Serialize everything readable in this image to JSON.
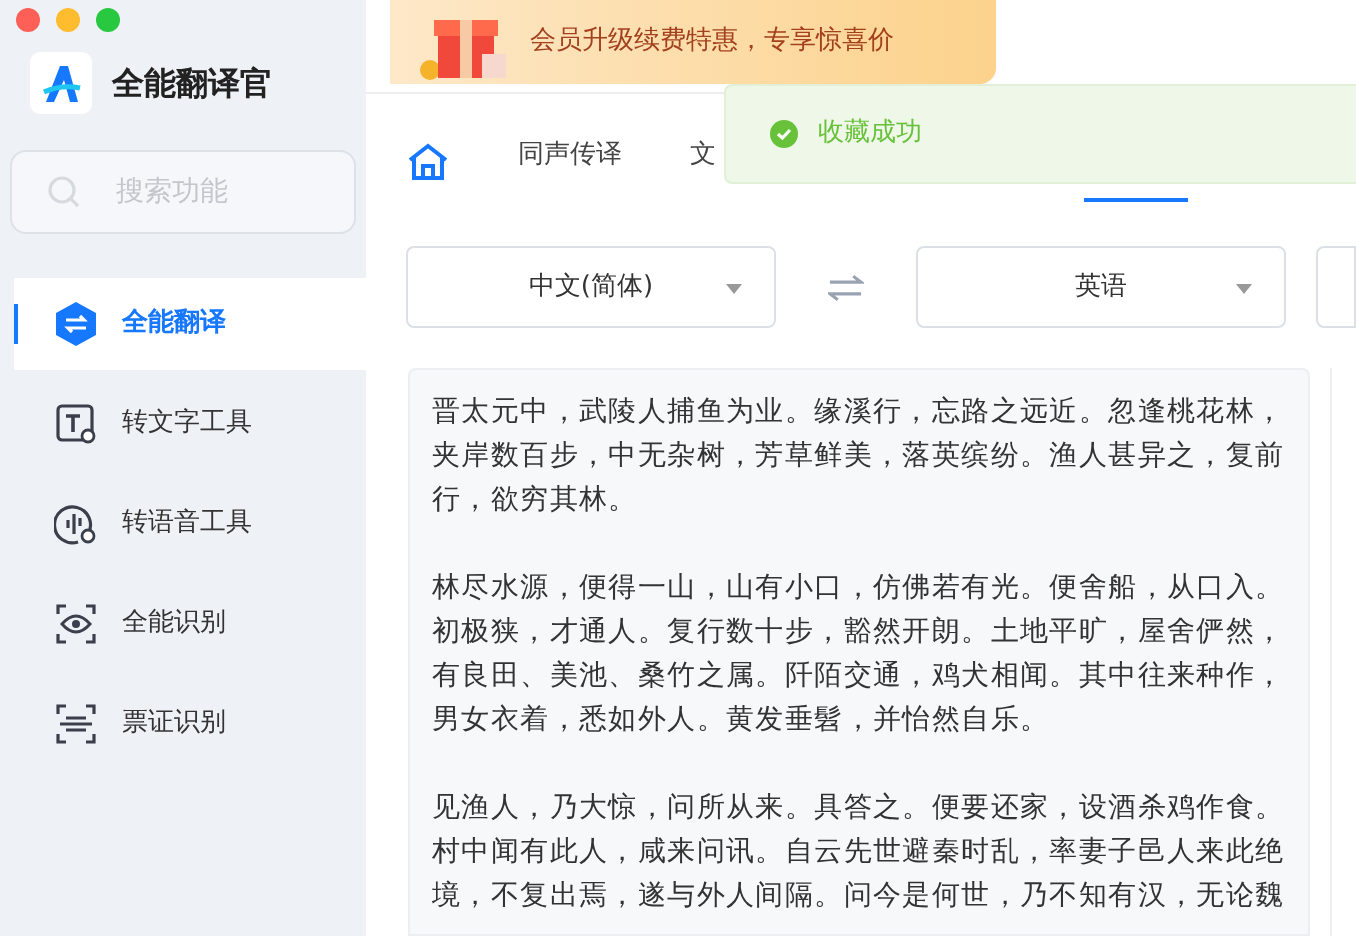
{
  "app": {
    "title": "全能翻译官"
  },
  "search": {
    "placeholder": "搜索功能"
  },
  "sidebar": {
    "items": [
      {
        "label": "全能翻译",
        "kind": "translate",
        "selected": true
      },
      {
        "label": "转文字工具",
        "kind": "text",
        "selected": false
      },
      {
        "label": "转语音工具",
        "kind": "voice",
        "selected": false
      },
      {
        "label": "全能识别",
        "kind": "eye",
        "selected": false
      },
      {
        "label": "票证识别",
        "kind": "scan",
        "selected": false
      }
    ]
  },
  "banner": {
    "text": "会员升级续费特惠，专享惊喜价"
  },
  "toast": {
    "kind": "success",
    "message": "收藏成功"
  },
  "tabs": [
    {
      "label": "同声传译",
      "selected": false
    },
    {
      "label": "文",
      "selected": false
    },
    {
      "selected": true
    }
  ],
  "languages": {
    "source": "中文(简体)",
    "target": "英语"
  },
  "source_text": [
    "晋太元中，武陵人捕鱼为业。缘溪行，忘路之远近。忽逢桃花林，夹岸数百步，中无杂树，芳草鲜美，落英缤纷。渔人甚异之，复前行，欲穷其林。",
    "林尽水源，便得一山，山有小口，仿佛若有光。便舍船，从口入。初极狭，才通人。复行数十步，豁然开朗。土地平旷，屋舍俨然，有良田、美池、桑竹之属。阡陌交通，鸡犬相闻。其中往来种作，男女衣着，悉如外人。黄发垂髫，并怡然自乐。",
    "见渔人，乃大惊，问所从来。具答之。便要还家，设酒杀鸡作食。村中闻有此人，咸来问讯。自云先世避秦时乱，率妻子邑人来此绝境，不复出焉，遂与外人间隔。问今是何世，乃不知有汉，无论魏"
  ]
}
